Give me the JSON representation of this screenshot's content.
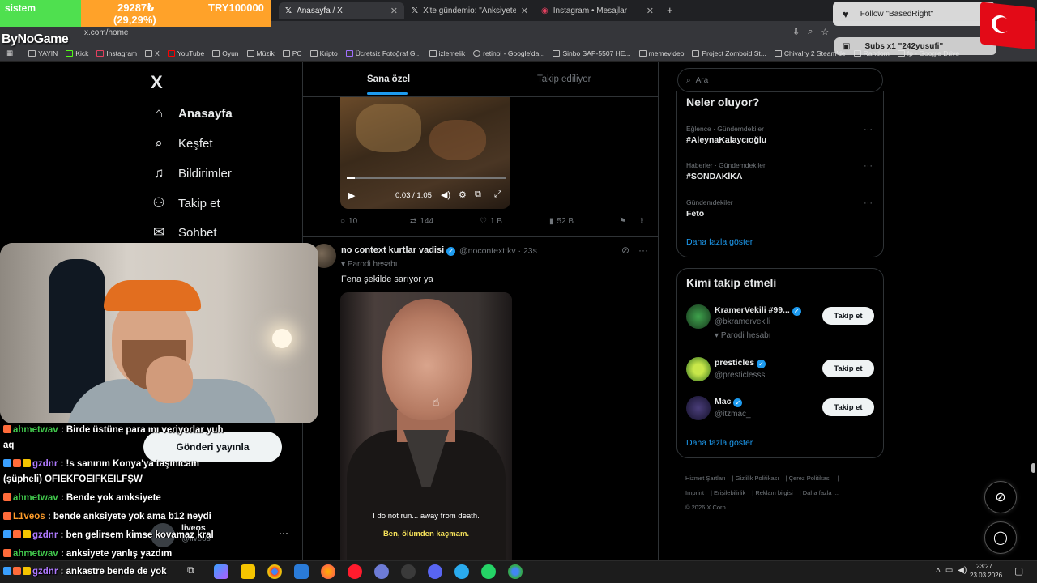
{
  "stream": {
    "stat_green": "sistem",
    "stat_count": "29287₺",
    "stat_percent": "(29,29%)",
    "stat_target": "TRY100000",
    "channel": "ByNoGame",
    "follow_alert": "Follow \"BasedRight\"",
    "subs_alert": "Subs x1 \"242yusufi\""
  },
  "browser": {
    "tabs": [
      {
        "label": "Anasayfa / X"
      },
      {
        "label": "X'te gündemio: \"Anksiyeteye k..."
      },
      {
        "label": "Instagram • Mesajlar"
      }
    ],
    "url": "x.com/home",
    "bookmarks": [
      "YAYIN",
      "Kick",
      "Instagram",
      "X",
      "YouTube",
      "Oyun",
      "Müzik",
      "PC",
      "Kripto",
      "Ücretsiz Fotoğraf G...",
      "izlemelik",
      "retinol - Google'da...",
      "Sinbo SAP-5507 HE...",
      "memevideo",
      "Project Zomboid St...",
      "Chivalry 2 Steam'de",
      "Random",
      "fp - Google Drive"
    ]
  },
  "nav": {
    "logo": "X",
    "items": [
      {
        "label": "Anasayfa",
        "icon": "home-icon"
      },
      {
        "label": "Keşfet",
        "icon": "search-icon"
      },
      {
        "label": "Bildirimler",
        "icon": "bell-icon"
      },
      {
        "label": "Takip et",
        "icon": "follow-icon"
      },
      {
        "label": "Sohbet",
        "icon": "mail-icon"
      }
    ],
    "post_button": "Gönderi yayınla",
    "account_name": "liveos",
    "account_handle": "@liveos"
  },
  "feed": {
    "tabs": [
      "Sana özel",
      "Takip ediliyor"
    ],
    "video1": {
      "time": "0:03 / 1:05",
      "progress": 0.05
    },
    "tweet1_stats": {
      "replies": "10",
      "reposts": "144",
      "likes": "1 B",
      "views": "52 B"
    },
    "tweet2": {
      "name": "no context kurtlar vadisi",
      "handle": "@nocontexttkv · 23s",
      "label": "Parodi hesabı",
      "text": "Fena şekilde sarıyor ya",
      "subtitle_en": "I do not run... away from death.",
      "subtitle_tr": "Ben, ölümden kaçmam."
    }
  },
  "sidebar": {
    "search_placeholder": "Ara",
    "trends_title": "Neler oluyor?",
    "trends": [
      {
        "category": "Eğlence · Gündemdekiler",
        "name": "#AleynaKalaycıoğlu"
      },
      {
        "category": "Haberler · Gündemdekiler",
        "name": "#SONDAKİKA"
      },
      {
        "category": "Gündemdekiler",
        "name": "Fetö"
      }
    ],
    "show_more": "Daha fazla göster",
    "wtf_title": "Kimi takip etmeli",
    "suggestions": [
      {
        "name": "KramerVekili #99...",
        "handle": "@bkramervekili",
        "note": "Parodi hesabı",
        "button": "Takip et"
      },
      {
        "name": "presticles",
        "handle": "@presticlesss",
        "note": "",
        "button": "Takip et"
      },
      {
        "name": "Mac",
        "handle": "@itzmac_",
        "note": "",
        "button": "Takip et"
      }
    ],
    "footer_links": [
      "Hizmet Şartları",
      "Gizlilik Politikası",
      "Çerez Politikası",
      "Imprint",
      "Erişilebilirlik",
      "Reklam bilgisi",
      "Daha fazla ...",
      "© 2026 X Corp."
    ]
  },
  "chat": [
    {
      "user": "ahmetwav",
      "text": ": Birde üstüne para mı veriyorlar yuh",
      "cont": "aq"
    },
    {
      "user": "gzdnr",
      "text": ": !s sanırım Konya'ya taşınıcam",
      "cont": "(şüpheli) OFIEKFOEIFKEILFŞW"
    },
    {
      "user": "ahmetwav",
      "text": ": Bende yok amksiyete"
    },
    {
      "user": "L1veos",
      "text": ": bende anksiyete yok ama b12 neydi"
    },
    {
      "user": "gzdnr",
      "text": ": ben gelirsem kimse kovamaz kral"
    },
    {
      "user": "ahmetwav",
      "text": ": anksiyete yanlış yazdım"
    },
    {
      "user": "gzdnr",
      "text": ": ankastre bende de yok"
    }
  ],
  "taskbar": {
    "time": "23:27",
    "date": "23.03.2026"
  },
  "colors": {
    "accent": "#1d9bf0",
    "bg": "#000000",
    "border": "#2f3336",
    "muted": "#71767b",
    "green": "#4fe04f",
    "orange": "#ffa229"
  }
}
